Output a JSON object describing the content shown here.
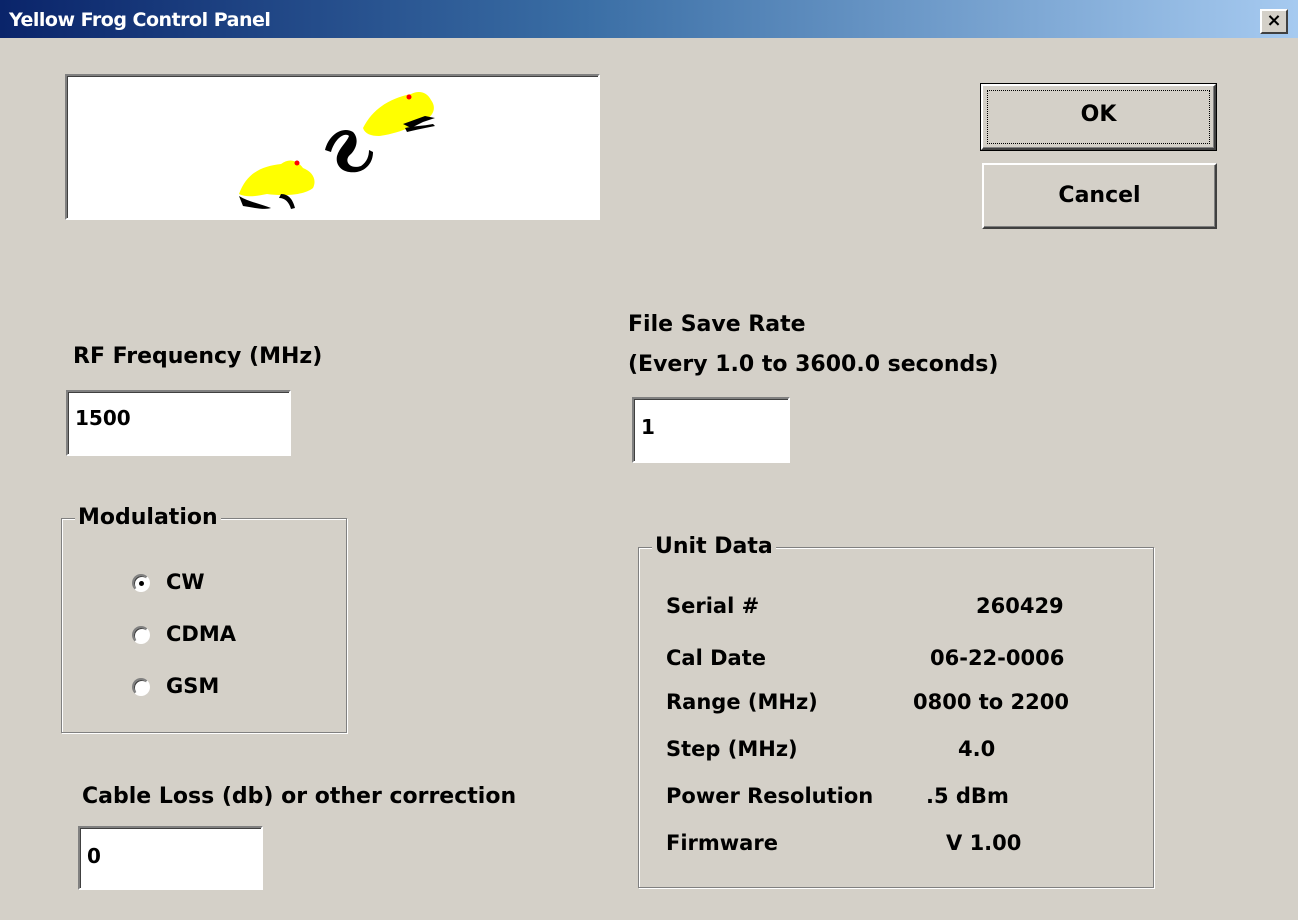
{
  "window": {
    "title": "Yellow Frog Control Panel",
    "close_glyph": "×"
  },
  "buttons": {
    "ok_label": "OK",
    "cancel_label": "Cancel"
  },
  "rf_frequency": {
    "label": "RF Frequency  (MHz)",
    "value": "1500"
  },
  "file_save_rate": {
    "label_line1": "File Save Rate",
    "label_line2": "(Every 1.0 to 3600.0 seconds)",
    "value": "1"
  },
  "modulation": {
    "title": "Modulation",
    "options": [
      {
        "label": "CW",
        "selected": true
      },
      {
        "label": "CDMA",
        "selected": false
      },
      {
        "label": "GSM",
        "selected": false
      }
    ]
  },
  "cable_loss": {
    "label": "Cable Loss (db) or other correction",
    "value": "0"
  },
  "unit_data": {
    "title": "Unit Data",
    "rows": [
      {
        "label": "Serial #",
        "value": "260429"
      },
      {
        "label": "Cal Date",
        "value": "06-22-0006"
      },
      {
        "label": "Range (MHz)",
        "value": "0800 to 2200"
      },
      {
        "label": "Step (MHz)",
        "value": "4.0"
      },
      {
        "label": "Power Resolution",
        "value": ".5 dBm"
      },
      {
        "label": "Firmware",
        "value": "V 1.00"
      }
    ]
  },
  "logo": {
    "icon": "yellow-frog-logo",
    "colors": {
      "frog": "#ffff00",
      "eye": "#ff0000",
      "outline": "#000000"
    }
  }
}
